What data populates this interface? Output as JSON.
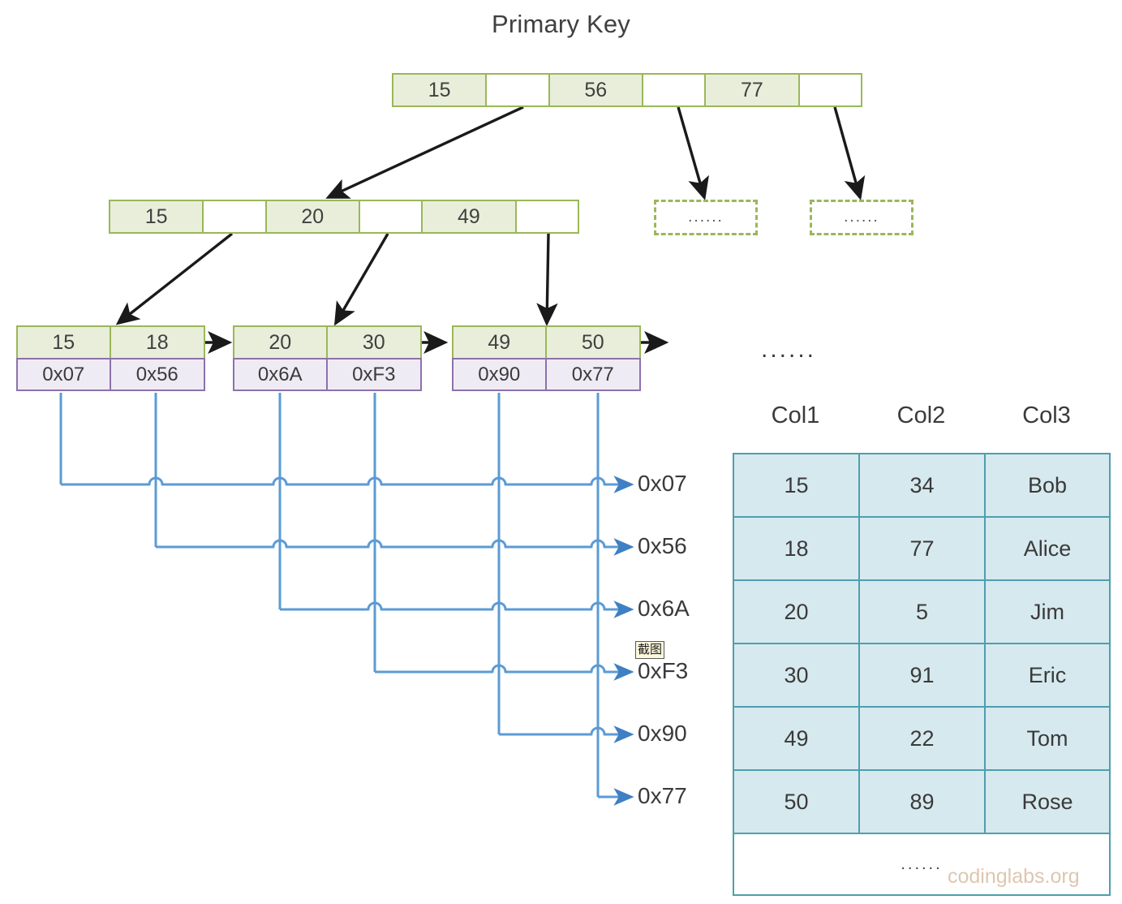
{
  "title": "Primary Key",
  "watermark": "codinglabs.org",
  "ellipsis": "......",
  "overlay_chip": {
    "label": "截图"
  },
  "colors": {
    "index_fill": "#e9eedb",
    "index_border": "#9ab759",
    "pointer_fill": "#efebf4",
    "pointer_border": "#8d71ac",
    "table_fill": "#d6e9ee",
    "table_border": "#4e9fae",
    "wire": "#5b9bd5",
    "arrow": "#1a1a1a"
  },
  "root_node": {
    "name": "root",
    "cells": [
      {
        "type": "key",
        "label": "15"
      },
      {
        "type": "ptr",
        "label": ""
      },
      {
        "type": "key",
        "label": "56"
      },
      {
        "type": "ptr",
        "label": ""
      },
      {
        "type": "key",
        "label": "77"
      },
      {
        "type": "ptr",
        "label": ""
      }
    ]
  },
  "internal_node": {
    "name": "internal-1",
    "cells": [
      {
        "type": "key",
        "label": "15"
      },
      {
        "type": "ptr",
        "label": ""
      },
      {
        "type": "key",
        "label": "20"
      },
      {
        "type": "ptr",
        "label": ""
      },
      {
        "type": "key",
        "label": "49"
      },
      {
        "type": "ptr",
        "label": ""
      }
    ]
  },
  "stub_nodes": [
    {
      "label": "......"
    },
    {
      "label": "......"
    }
  ],
  "leaf_nodes": [
    {
      "name": "leaf-1",
      "keys": [
        "15",
        "18"
      ],
      "pointers": [
        "0x07",
        "0x56"
      ]
    },
    {
      "name": "leaf-2",
      "keys": [
        "20",
        "30"
      ],
      "pointers": [
        "0x6A",
        "0xF3"
      ]
    },
    {
      "name": "leaf-3",
      "keys": [
        "49",
        "50"
      ],
      "pointers": [
        "0x90",
        "0x77"
      ]
    }
  ],
  "leaf_tail_ellipsis": "......",
  "address_labels": [
    "0x07",
    "0x56",
    "0x6A",
    "0xF3",
    "0x90",
    "0x77"
  ],
  "data_table": {
    "headers": [
      "Col1",
      "Col2",
      "Col3"
    ],
    "rows": [
      [
        "15",
        "34",
        "Bob"
      ],
      [
        "18",
        "77",
        "Alice"
      ],
      [
        "20",
        "5",
        "Jim"
      ],
      [
        "30",
        "91",
        "Eric"
      ],
      [
        "49",
        "22",
        "Tom"
      ],
      [
        "50",
        "89",
        "Rose"
      ]
    ],
    "more_row": "......"
  },
  "chart_data": {
    "type": "diagram",
    "subtype": "b+tree-clustered-index",
    "title": "Primary Key",
    "levels": [
      {
        "level": 0,
        "keys": [
          "15",
          "56",
          "77"
        ]
      },
      {
        "level": 1,
        "keys": [
          "15",
          "20",
          "49"
        ]
      },
      {
        "level": 2,
        "keys": [
          "15",
          "18",
          "20",
          "30",
          "49",
          "50"
        ],
        "pointers": [
          "0x07",
          "0x56",
          "0x6A",
          "0xF3",
          "0x90",
          "0x77"
        ]
      }
    ],
    "record_table": {
      "columns": [
        "Col1",
        "Col2",
        "Col3"
      ],
      "rows": [
        [
          "15",
          "34",
          "Bob"
        ],
        [
          "18",
          "77",
          "Alice"
        ],
        [
          "20",
          "5",
          "Jim"
        ],
        [
          "30",
          "91",
          "Eric"
        ],
        [
          "49",
          "22",
          "Tom"
        ],
        [
          "50",
          "89",
          "Rose"
        ]
      ]
    },
    "pointer_to_row": {
      "0x07": "15",
      "0x56": "18",
      "0x6A": "20",
      "0xF3": "30",
      "0x90": "49",
      "0x77": "50"
    }
  }
}
